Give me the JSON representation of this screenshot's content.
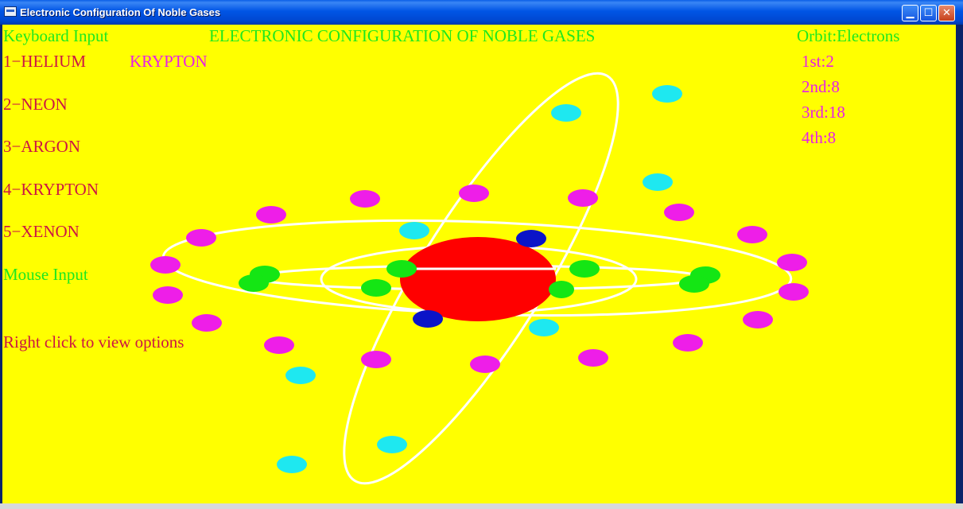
{
  "window": {
    "title": "Electronic Configuration Of Noble Gases",
    "controls": {
      "minimize": "▁",
      "maximize": "☐",
      "close": "✕"
    }
  },
  "canvas": {
    "keyboard_header": "Keyboard Input",
    "main_title": "ELECTRONIC CONFIGURATION OF NOBLE GASES",
    "orbit_header": "Orbit:Electrons",
    "selected_element": "KRYPTON",
    "menu": [
      "1−HELIUM",
      "2−NEON",
      "3−ARGON",
      "4−KRYPTON",
      "5−XENON"
    ],
    "mouse_header": "Mouse Input",
    "mouse_hint": "Right click to view options",
    "orbits": [
      "1st:2",
      "2nd:8",
      "3rd:18",
      "4th:8"
    ]
  },
  "colors": {
    "background": "#ffff00",
    "header_text": "#1ee81e",
    "menu_text": "#cc1544",
    "highlight_text": "#e81ee8",
    "nucleus": "#ff0000",
    "orbit_line": "#ffffff",
    "shell1_electron": "#0a14c8",
    "shell2_electron": "#14e614",
    "shell3_electron": "#ee1ee8",
    "shell4_electron": "#1ee8f0"
  }
}
